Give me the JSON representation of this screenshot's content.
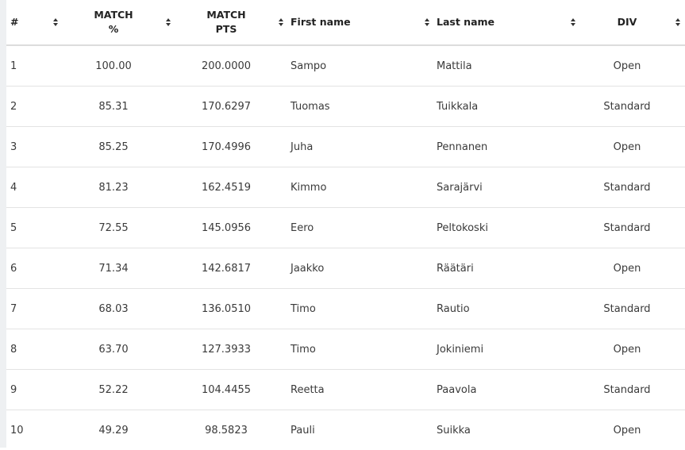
{
  "columns": {
    "rank": {
      "line1": "#",
      "line2": ""
    },
    "match_pct": {
      "line1": "MATCH",
      "line2": "%"
    },
    "match_pts": {
      "line1": "MATCH",
      "line2": "PTS"
    },
    "first_name": {
      "line1": "First name",
      "line2": ""
    },
    "last_name": {
      "line1": "Last name",
      "line2": ""
    },
    "division": {
      "line1": "DIV",
      "line2": ""
    }
  },
  "rows": [
    {
      "rank": "1",
      "match_pct": "100.00",
      "match_pts": "200.0000",
      "first_name": "Sampo",
      "last_name": "Mattila",
      "division": "Open"
    },
    {
      "rank": "2",
      "match_pct": "85.31",
      "match_pts": "170.6297",
      "first_name": "Tuomas",
      "last_name": "Tuikkala",
      "division": "Standard"
    },
    {
      "rank": "3",
      "match_pct": "85.25",
      "match_pts": "170.4996",
      "first_name": "Juha",
      "last_name": "Pennanen",
      "division": "Open"
    },
    {
      "rank": "4",
      "match_pct": "81.23",
      "match_pts": "162.4519",
      "first_name": "Kimmo",
      "last_name": "Sarajärvi",
      "division": "Standard"
    },
    {
      "rank": "5",
      "match_pct": "72.55",
      "match_pts": "145.0956",
      "first_name": "Eero",
      "last_name": "Peltokoski",
      "division": "Standard"
    },
    {
      "rank": "6",
      "match_pct": "71.34",
      "match_pts": "142.6817",
      "first_name": "Jaakko",
      "last_name": "Räätäri",
      "division": "Open"
    },
    {
      "rank": "7",
      "match_pct": "68.03",
      "match_pts": "136.0510",
      "first_name": "Timo",
      "last_name": "Rautio",
      "division": "Standard"
    },
    {
      "rank": "8",
      "match_pct": "63.70",
      "match_pts": "127.3933",
      "first_name": "Timo",
      "last_name": "Jokiniemi",
      "division": "Open"
    },
    {
      "rank": "9",
      "match_pct": "52.22",
      "match_pts": "104.4455",
      "first_name": "Reetta",
      "last_name": "Paavola",
      "division": "Standard"
    },
    {
      "rank": "10",
      "match_pct": "49.29",
      "match_pts": "98.5823",
      "first_name": "Pauli",
      "last_name": "Suikka",
      "division": "Open"
    }
  ],
  "icons": {
    "sort": "sort-icon"
  },
  "colors": {
    "header_text": "#222222",
    "cell_text": "#3a3a3a",
    "row_divider": "#e3e3e3",
    "header_divider": "#dcdcdc"
  }
}
